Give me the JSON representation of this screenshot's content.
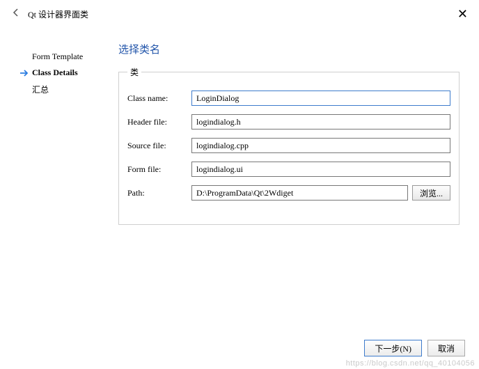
{
  "window": {
    "title": "Qt 设计器界面类"
  },
  "sidebar": {
    "items": [
      {
        "label": "Form Template"
      },
      {
        "label": "Class Details"
      },
      {
        "label": "汇总"
      }
    ]
  },
  "main": {
    "page_title": "选择类名",
    "group_legend": "类",
    "fields": {
      "class_name_label": "Class name:",
      "class_name_value": "LoginDialog",
      "header_file_label": "Header file:",
      "header_file_value": "logindialog.h",
      "source_file_label": "Source file:",
      "source_file_value": "logindialog.cpp",
      "form_file_label": "Form file:",
      "form_file_value": "logindialog.ui",
      "path_label": "Path:",
      "path_value": "D:\\ProgramData\\Qt\\2Wdiget",
      "browse_label": "浏览..."
    }
  },
  "buttons": {
    "next": "下一步(N)",
    "cancel": "取消"
  },
  "watermark": "https://blog.csdn.net/qq_40104056"
}
